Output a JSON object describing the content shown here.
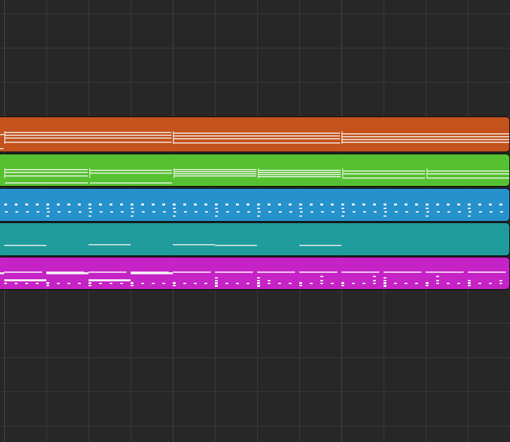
{
  "arrange_window": {
    "background_color": "#272727",
    "grid_line_color": "#3a3a3a",
    "bar_line_color": "#454545",
    "region_border_color": "#0a0a0a",
    "note_color": "#f6f6f6"
  },
  "regions": [
    {
      "id": "orange",
      "color": "#c4521c",
      "pattern": "sustained-chords"
    },
    {
      "id": "green",
      "color": "#56c130",
      "pattern": "pad-chords"
    },
    {
      "id": "blue",
      "color": "#2692cc",
      "pattern": "rhythmic-dashes"
    },
    {
      "id": "teal",
      "color": "#209c9c",
      "pattern": "bass-notes"
    },
    {
      "id": "magenta",
      "color": "#c623c6",
      "pattern": "drum-pattern"
    }
  ]
}
